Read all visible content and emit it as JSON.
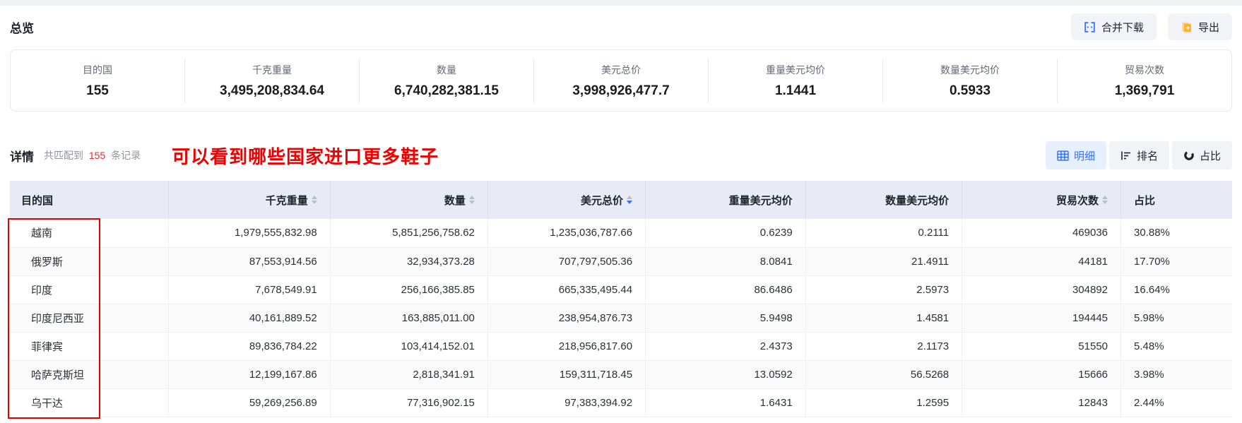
{
  "overview": {
    "title": "总览",
    "stats": [
      {
        "label": "目的国",
        "value": "155"
      },
      {
        "label": "千克重量",
        "value": "3,495,208,834.64"
      },
      {
        "label": "数量",
        "value": "6,740,282,381.15"
      },
      {
        "label": "美元总价",
        "value": "3,998,926,477.7"
      },
      {
        "label": "重量美元均价",
        "value": "1.1441"
      },
      {
        "label": "数量美元均价",
        "value": "0.5933"
      },
      {
        "label": "贸易次数",
        "value": "1,369,791"
      }
    ]
  },
  "toolbar": {
    "merge_download_label": "合并下载",
    "export_label": "导出"
  },
  "details": {
    "title": "详情",
    "match_prefix": "共匹配到",
    "match_count": "155",
    "match_suffix": "条记录",
    "annotation": "可以看到哪些国家进口更多鞋子",
    "views": {
      "detail_label": "明细",
      "rank_label": "排名",
      "share_label": "占比"
    }
  },
  "table": {
    "columns": [
      {
        "label": "目的国",
        "sortable": false
      },
      {
        "label": "千克重量",
        "sortable": true
      },
      {
        "label": "数量",
        "sortable": true
      },
      {
        "label": "美元总价",
        "sortable": true,
        "sorted": "desc"
      },
      {
        "label": "重量美元均价",
        "sortable": false
      },
      {
        "label": "数量美元均价",
        "sortable": false
      },
      {
        "label": "贸易次数",
        "sortable": true
      },
      {
        "label": "占比",
        "sortable": false
      }
    ],
    "rows": [
      [
        "越南",
        "1,979,555,832.98",
        "5,851,256,758.62",
        "1,235,036,787.66",
        "0.6239",
        "0.2111",
        "469036",
        "30.88%"
      ],
      [
        "俄罗斯",
        "87,553,914.56",
        "32,934,373.28",
        "707,797,505.36",
        "8.0841",
        "21.4911",
        "44181",
        "17.70%"
      ],
      [
        "印度",
        "7,678,549.91",
        "256,166,385.85",
        "665,335,495.44",
        "86.6486",
        "2.5973",
        "304892",
        "16.64%"
      ],
      [
        "印度尼西亚",
        "40,161,889.52",
        "163,885,011.00",
        "238,954,876.73",
        "5.9498",
        "1.4581",
        "194445",
        "5.98%"
      ],
      [
        "菲律宾",
        "89,836,784.22",
        "103,414,152.01",
        "218,956,817.60",
        "2.4373",
        "2.1173",
        "51550",
        "5.48%"
      ],
      [
        "哈萨克斯坦",
        "12,199,167.86",
        "2,818,341.91",
        "159,311,718.45",
        "13.0592",
        "56.5268",
        "15666",
        "3.98%"
      ],
      [
        "乌干达",
        "59,269,256.89",
        "77,316,902.15",
        "97,383,394.92",
        "1.6431",
        "1.2595",
        "12843",
        "2.44%"
      ]
    ]
  },
  "colors": {
    "accent_blue": "#3370ff",
    "count_red": "#f5222d",
    "annotation_red": "#ee0000",
    "table_header_bg": "#e8ebf5",
    "export_orange": "#ffb02e"
  }
}
